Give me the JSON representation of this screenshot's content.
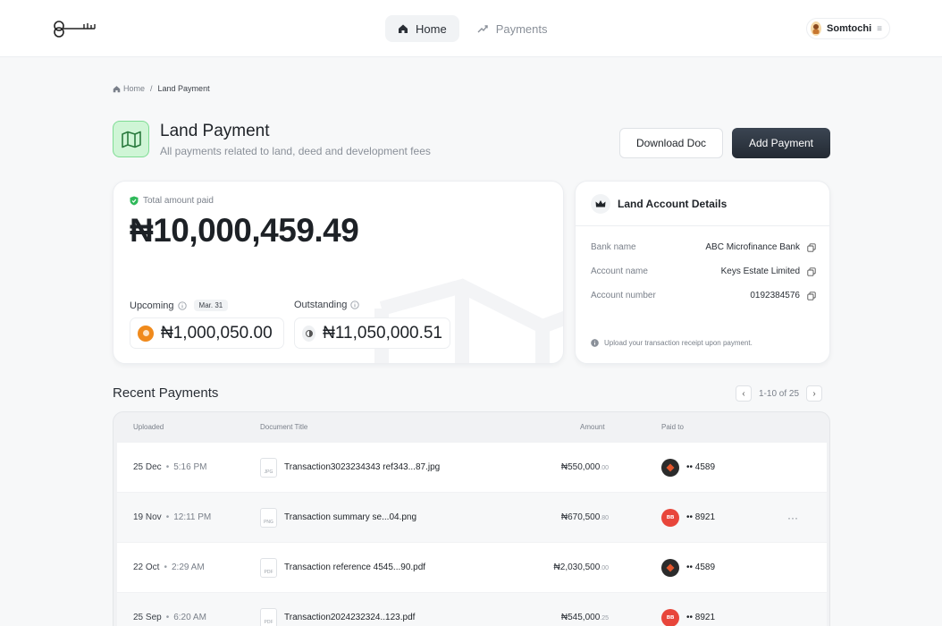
{
  "nav": {
    "home": "Home",
    "payments": "Payments"
  },
  "user": {
    "name": "Somtochi"
  },
  "breadcrumb": {
    "home": "Home",
    "separator": "/",
    "current": "Land Payment"
  },
  "page": {
    "title": "Land Payment",
    "subtitle": "All payments related to land, deed and development fees"
  },
  "actions": {
    "download": "Download Doc",
    "add": "Add Payment"
  },
  "summary": {
    "total_label": "Total amount paid",
    "total_amount": "₦10,000,459.49",
    "upcoming_label": "Upcoming",
    "upcoming_date": "Mar. 31",
    "upcoming_amount": "₦1,000,050.00",
    "outstanding_label": "Outstanding",
    "outstanding_amount": "₦11,050,000.51"
  },
  "account": {
    "title": "Land Account Details",
    "bank_label": "Bank name",
    "bank_value": "ABC Microfinance Bank",
    "name_label": "Account name",
    "name_value": "Keys Estate Limited",
    "number_label": "Account number",
    "number_value": "0192384576",
    "note": "Upload your transaction receipt upon payment."
  },
  "recent": {
    "title": "Recent Payments",
    "pagination": "1-10 of 25",
    "headers": {
      "uploaded": "Uploaded",
      "title": "Document Title",
      "amount": "Amount",
      "paid_to": "Paid to"
    },
    "rows": [
      {
        "date": "25 Dec",
        "sep": "•",
        "time": "5:16 PM",
        "type": "JPG",
        "doc": "Transaction3023234343 ref343...87.jpg",
        "amount": "₦550,000",
        "cents": ".00",
        "account": "•• 4589",
        "bank_color": "#2b2b2b"
      },
      {
        "date": "19 Nov",
        "sep": "•",
        "time": "12:11 PM",
        "type": "PNG",
        "doc": "Transaction summary se...04.png",
        "amount": "₦670,500",
        "cents": ".80",
        "account": "•• 8921",
        "bank_color": "#e8463b",
        "menu": "···"
      },
      {
        "date": "22 Oct",
        "sep": "•",
        "time": "2:29 AM",
        "type": "PDF",
        "doc": "Transaction reference 4545...90.pdf",
        "amount": "₦2,030,500",
        "cents": ".00",
        "account": "•• 4589",
        "bank_color": "#2b2b2b"
      },
      {
        "date": "25 Sep",
        "sep": "•",
        "time": "6:20 AM",
        "type": "PDF",
        "doc": "Transaction2024232324..123.pdf",
        "amount": "₦545,000",
        "cents": ".25",
        "account": "•• 8921",
        "bank_color": "#e8463b"
      }
    ]
  },
  "icons": {
    "logo": "logo-mark",
    "home": "home-icon",
    "payments": "payments-icon",
    "map": "map-icon",
    "shield": "shield-check-icon",
    "info": "info-icon",
    "copy": "copy-icon",
    "crown": "crown-icon"
  },
  "colors": {
    "primary_dark": "#2a323c",
    "brand_green": "#cff5d6",
    "upcoming_coin": "#f08a1c",
    "bank_red": "#e8463b",
    "bank_dark": "#2b2b2b"
  }
}
